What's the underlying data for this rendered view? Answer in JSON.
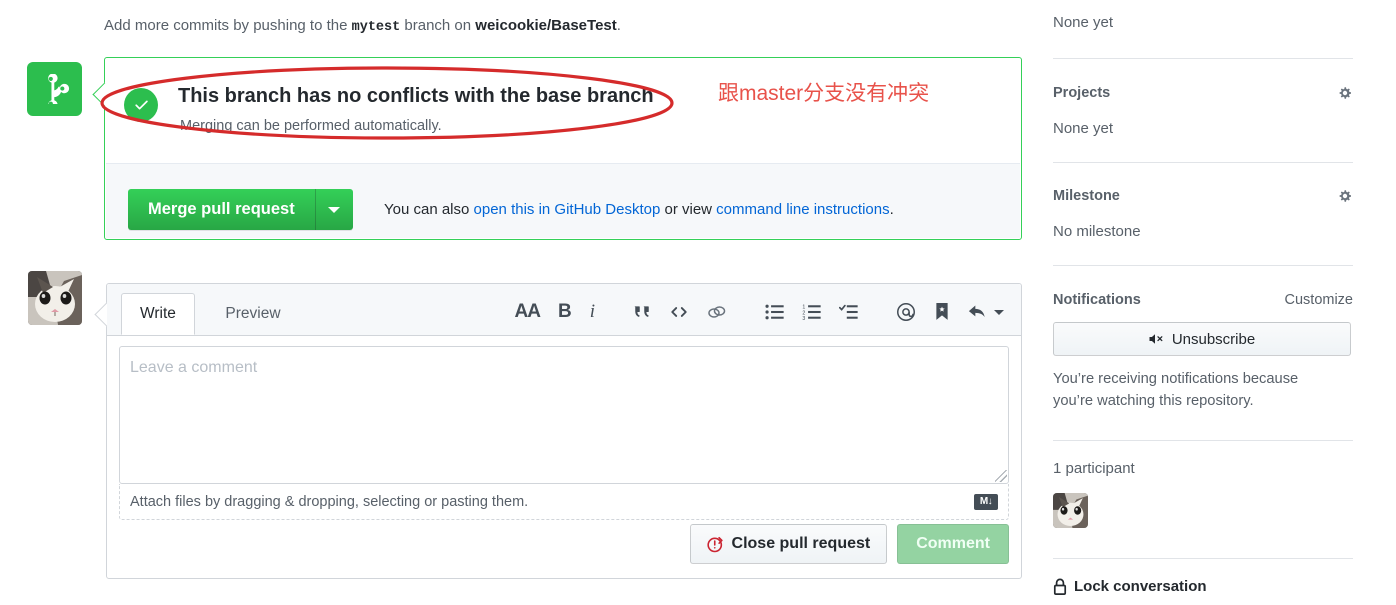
{
  "main": {
    "push_note": {
      "prefix": "Add more commits by pushing to the ",
      "branch": "mytest",
      "middle": " branch on ",
      "repo": "weicookie/BaseTest",
      "suffix": "."
    },
    "merge_status": {
      "title": "This branch has no conflicts with the base branch",
      "subtitle": "Merging can be performed automatically.",
      "merge_button": "Merge pull request",
      "alt_prefix": "You can also ",
      "alt_link1": "open this in GitHub Desktop",
      "alt_middle": " or view ",
      "alt_link2": "command line instructions",
      "alt_suffix": "."
    },
    "annotation": {
      "text": "跟master分支没有冲突",
      "color": "#e8524a"
    },
    "comment_form": {
      "tab_write": "Write",
      "tab_preview": "Preview",
      "toolbar": [
        {
          "name": "heading-icon",
          "label": "AA"
        },
        {
          "name": "bold-icon",
          "label": "B"
        },
        {
          "name": "italic-icon",
          "label": "i"
        },
        {
          "name": "quote-icon",
          "label": "“"
        },
        {
          "name": "code-icon",
          "label": "<>"
        },
        {
          "name": "link-icon",
          "label": "link"
        },
        {
          "name": "unordered-list-icon",
          "label": "list"
        },
        {
          "name": "ordered-list-icon",
          "label": "numlist"
        },
        {
          "name": "task-list-icon",
          "label": "tasklist"
        },
        {
          "name": "mention-icon",
          "label": "@"
        },
        {
          "name": "reference-icon",
          "label": "bookmark"
        },
        {
          "name": "saved-reply-icon",
          "label": "reply"
        }
      ],
      "textarea_placeholder": "Leave a comment",
      "textarea_value": "",
      "attach_text": "Attach files by dragging & dropping, selecting or pasting them.",
      "markdown_badge": "M↓",
      "close_button": "Close pull request",
      "comment_button": "Comment"
    }
  },
  "sidebar": {
    "assignees_value": "None yet",
    "projects_title": "Projects",
    "projects_value": "None yet",
    "milestone_title": "Milestone",
    "milestone_value": "No milestone",
    "notifications_title": "Notifications",
    "notifications_customize": "Customize",
    "unsubscribe_button": "Unsubscribe",
    "notifications_note": "You’re receiving notifications because you’re watching this repository.",
    "participants_count": "1 participant",
    "lock_conversation": "Lock conversation"
  },
  "colors": {
    "green": "#2cbe4e",
    "link": "#0366d6",
    "annotation_red": "#e8524a"
  }
}
